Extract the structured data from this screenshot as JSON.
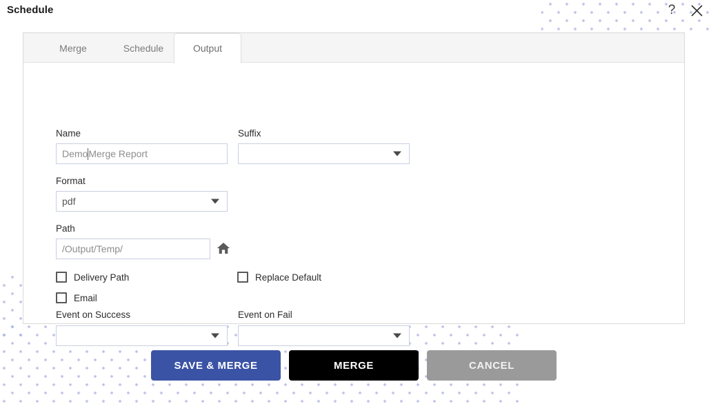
{
  "window": {
    "title": "Schedule",
    "help_icon": "question-mark-icon",
    "close_icon": "close-icon"
  },
  "tabs": [
    {
      "label": "Merge",
      "active": false
    },
    {
      "label": "Schedule",
      "active": false
    },
    {
      "label": "Output",
      "active": true
    }
  ],
  "form": {
    "name": {
      "label": "Name",
      "value": "Demo ",
      "value_rest": "Merge Report",
      "full_value": "Demo Merge Report"
    },
    "suffix": {
      "label": "Suffix",
      "value": ""
    },
    "format": {
      "label": "Format",
      "value": "pdf"
    },
    "path": {
      "label": "Path",
      "value": "/Output/Temp/",
      "browse_icon": "home-icon"
    },
    "checkboxes": [
      {
        "label": "Delivery Path",
        "checked": false
      },
      {
        "label": "Email",
        "checked": false
      },
      {
        "label": "Replace Default",
        "checked": false
      }
    ],
    "event_on_success": {
      "label": "Event on Success",
      "value": ""
    },
    "event_on_fail": {
      "label": "Event on Fail",
      "value": ""
    }
  },
  "actions": {
    "save_merge": "SAVE & MERGE",
    "merge": "MERGE",
    "cancel": "CANCEL"
  },
  "colors": {
    "primary": "#3b53a4",
    "secondary": "#000000",
    "muted": "#9a9a9a",
    "pattern": "#a9b3e2",
    "panel_border": "#d9d9d9",
    "tabbar_bg": "#f5f5f5",
    "field_border": "#c9cfe0"
  }
}
